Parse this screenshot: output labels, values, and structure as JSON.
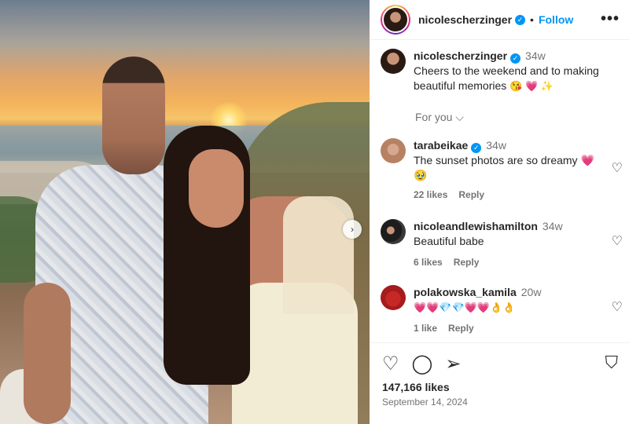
{
  "post": {
    "author": "nicolescherzinger",
    "follow_label": "Follow",
    "separator": "•",
    "more_label": "•••",
    "next_label": "›"
  },
  "caption": {
    "username": "nicolescherzinger",
    "time": "34w",
    "text": "Cheers to the weekend and to making beautiful memories",
    "emojis": "😘 💗 ✨"
  },
  "for_you": "For you ⌵",
  "comments": [
    {
      "username": "tarabeikae",
      "time": "34w",
      "text": "The sunset photos are so dreamy 💗 🥹",
      "likes": "22 likes",
      "reply": "Reply"
    },
    {
      "username": "nicoleandlewishamilton",
      "time": "34w",
      "text": "Beautiful babe",
      "likes": "6 likes",
      "reply": "Reply"
    },
    {
      "username": "polakowska_kamila",
      "time": "20w",
      "text": "💗💗💎💎💗💗👌👌",
      "likes": "1 like",
      "reply": "Reply"
    }
  ],
  "footer": {
    "likes": "147,166 likes",
    "date": "September 14, 2024"
  },
  "icons": {
    "heart": "♡",
    "comment": "◯",
    "share": "➢",
    "save": "⛉",
    "verified": "✓"
  },
  "colors": {
    "link_blue": "#0095f6",
    "muted": "#737373",
    "text": "#262626"
  }
}
